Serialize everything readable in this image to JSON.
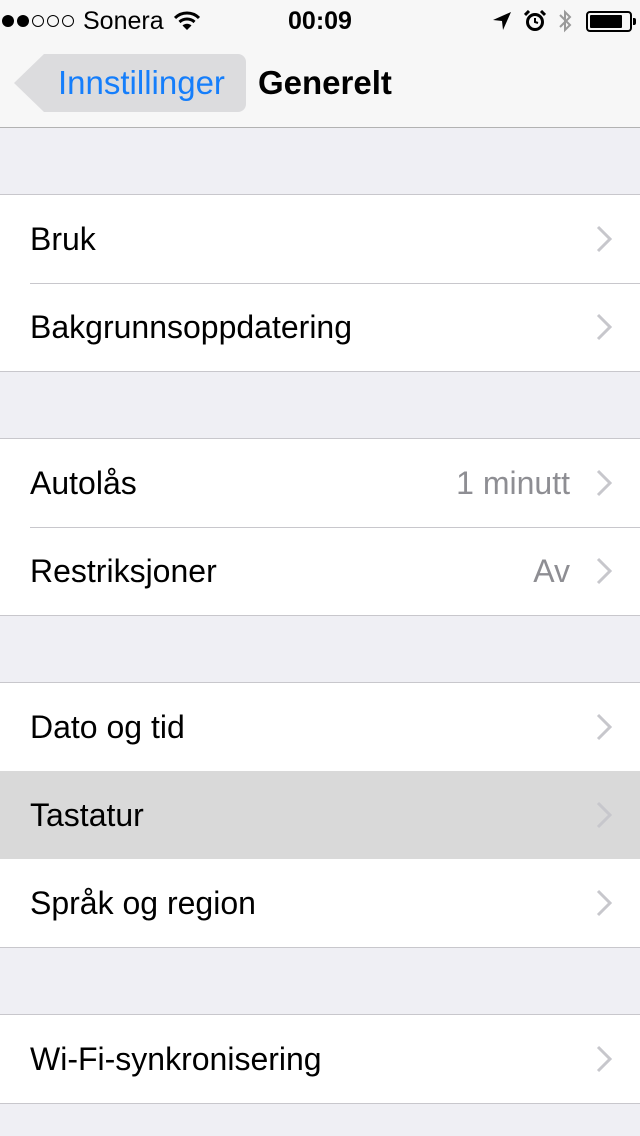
{
  "status_bar": {
    "signal_filled": 2,
    "signal_total": 5,
    "carrier": "Sonera",
    "time": "00:09",
    "icons": [
      "wifi-icon",
      "location-arrow-icon",
      "alarm-icon",
      "bluetooth-icon",
      "battery-icon"
    ],
    "battery_level": 0.85
  },
  "navbar": {
    "back_label": "Innstillinger",
    "title": "Generelt"
  },
  "groups": [
    {
      "rows": [
        {
          "label": "Bruk",
          "value": ""
        },
        {
          "label": "Bakgrunnsoppdatering",
          "value": ""
        }
      ]
    },
    {
      "rows": [
        {
          "label": "Autolås",
          "value": "1 minutt"
        },
        {
          "label": "Restriksjoner",
          "value": "Av"
        }
      ]
    },
    {
      "rows": [
        {
          "label": "Dato og tid",
          "value": ""
        },
        {
          "label": "Tastatur",
          "value": "",
          "selected": true
        },
        {
          "label": "Språk og region",
          "value": ""
        }
      ]
    },
    {
      "rows": [
        {
          "label": "Wi-Fi-synkronisering",
          "value": ""
        }
      ]
    }
  ],
  "colors": {
    "accent": "#157efb",
    "background": "#efeff4",
    "separator": "#c8c7cc",
    "value_text": "#8e8e93",
    "chevron": "#c7c7cc",
    "selected_row": "#d9d9d9"
  }
}
